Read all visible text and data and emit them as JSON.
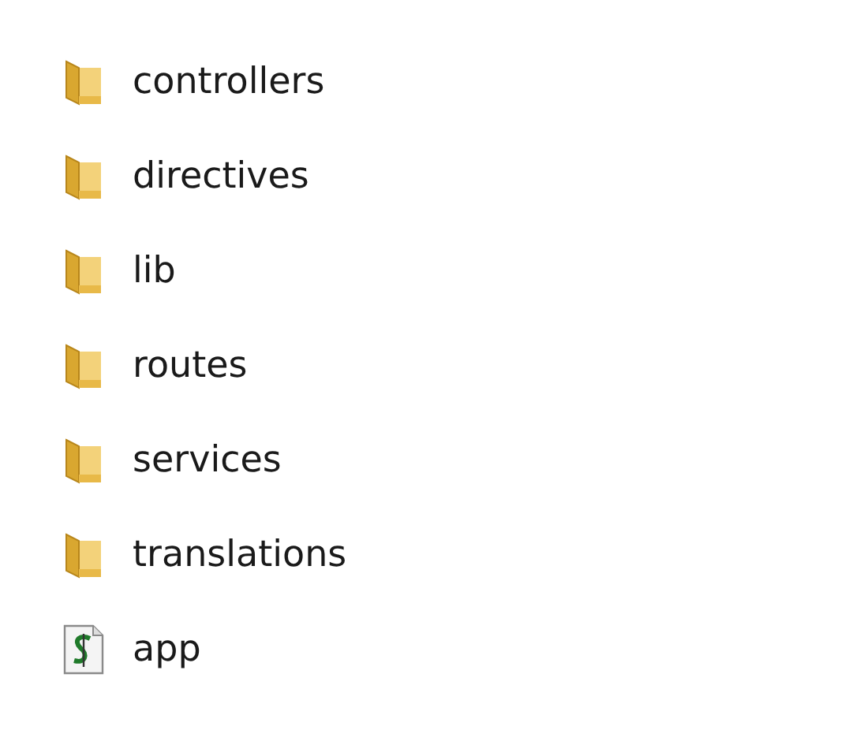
{
  "items": [
    {
      "name": "controllers",
      "kind": "folder"
    },
    {
      "name": "directives",
      "kind": "folder"
    },
    {
      "name": "lib",
      "kind": "folder"
    },
    {
      "name": "routes",
      "kind": "folder"
    },
    {
      "name": "services",
      "kind": "folder"
    },
    {
      "name": "translations",
      "kind": "folder"
    },
    {
      "name": "app",
      "kind": "script"
    }
  ]
}
